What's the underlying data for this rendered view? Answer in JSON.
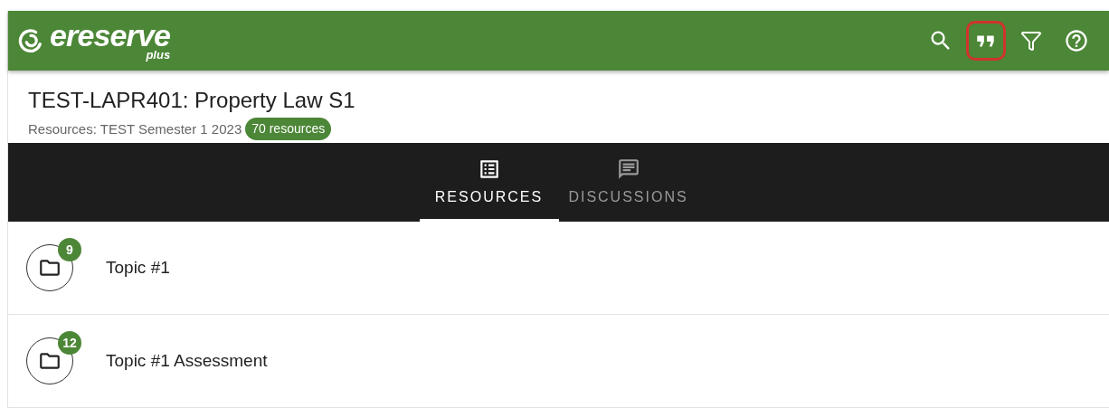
{
  "header": {
    "logo": {
      "name": "ereserve",
      "sub": "plus"
    },
    "actions": [
      {
        "kind": "search",
        "highlighted": false
      },
      {
        "kind": "quote",
        "highlighted": true
      },
      {
        "kind": "filter",
        "highlighted": false
      },
      {
        "kind": "help",
        "highlighted": false
      }
    ]
  },
  "course": {
    "title": "TEST-LAPR401: Property Law S1",
    "subtitle": "Resources: TEST Semester 1 2023",
    "badge": "70 resources"
  },
  "tabs": [
    {
      "kind": "resources",
      "label": "RESOURCES",
      "selected": true
    },
    {
      "kind": "discussions",
      "label": "DISCUSSIONS",
      "selected": false
    }
  ],
  "topics": [
    {
      "title": "Topic #1",
      "count": "9"
    },
    {
      "title": "Topic #1 Assessment",
      "count": "12"
    }
  ]
}
